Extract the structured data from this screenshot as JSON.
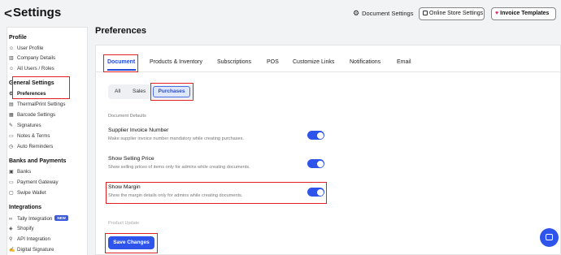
{
  "header": {
    "back_glyph": "<",
    "title": "Settings",
    "document_settings": "Document Settings",
    "online_store_settings": "Online Store Settings",
    "invoice_templates": "Invoice Templates"
  },
  "sidebar": {
    "sections": [
      {
        "title": "Profile",
        "items": [
          {
            "label": "User Profile",
            "icon": "user-icon"
          },
          {
            "label": "Company Details",
            "icon": "building-icon"
          },
          {
            "label": "All Users / Roles",
            "icon": "users-icon"
          }
        ]
      },
      {
        "title": "General Settings",
        "items": [
          {
            "label": "Preferences",
            "icon": "gear-icon",
            "active": true
          },
          {
            "label": "ThermalPrint Settings",
            "icon": "printer-icon"
          },
          {
            "label": "Barcode Settings",
            "icon": "barcode-icon"
          },
          {
            "label": "Signatures",
            "icon": "pen-icon"
          },
          {
            "label": "Notes & Terms",
            "icon": "note-icon"
          },
          {
            "label": "Auto Reminders",
            "icon": "clock-icon"
          }
        ]
      },
      {
        "title": "Banks and Payments",
        "items": [
          {
            "label": "Banks",
            "icon": "bank-icon"
          },
          {
            "label": "Payment Gateway",
            "icon": "card-icon"
          },
          {
            "label": "Swipe Wallet",
            "icon": "wallet-icon"
          }
        ]
      },
      {
        "title": "Integrations",
        "items": [
          {
            "label": "Tally Integration",
            "icon": "link-icon",
            "badge": "NEW"
          },
          {
            "label": "Shopify",
            "icon": "bag-icon"
          },
          {
            "label": "API Integration",
            "icon": "code-icon"
          },
          {
            "label": "Digital Signature",
            "icon": "signature-icon"
          }
        ]
      }
    ]
  },
  "main": {
    "title": "Preferences",
    "tabs": [
      "Document",
      "Products & Inventory",
      "Subscriptions",
      "POS",
      "Customize Links",
      "Notifications",
      "Email"
    ],
    "active_tab": "Document",
    "segments": [
      "All",
      "Sales",
      "Purchases"
    ],
    "active_segment": "Purchases",
    "section_label": "Document Defaults",
    "preferences": [
      {
        "title": "Supplier Invoice Number",
        "desc": "Make supplier invoice number mandatory while creating purchases.",
        "enabled": true
      },
      {
        "title": "Show Selling Price",
        "desc": "Show selling prices of items only for admins while creating documents.",
        "enabled": true
      },
      {
        "title": "Show Margin",
        "desc": "Show the margin details only for admins while creating documents.",
        "enabled": true
      }
    ],
    "next_section_label": "Product Update",
    "save_label": "Save Changes"
  },
  "colors": {
    "accent": "#2f54eb",
    "highlight": "#e02020",
    "background": "#f2f3f5"
  }
}
